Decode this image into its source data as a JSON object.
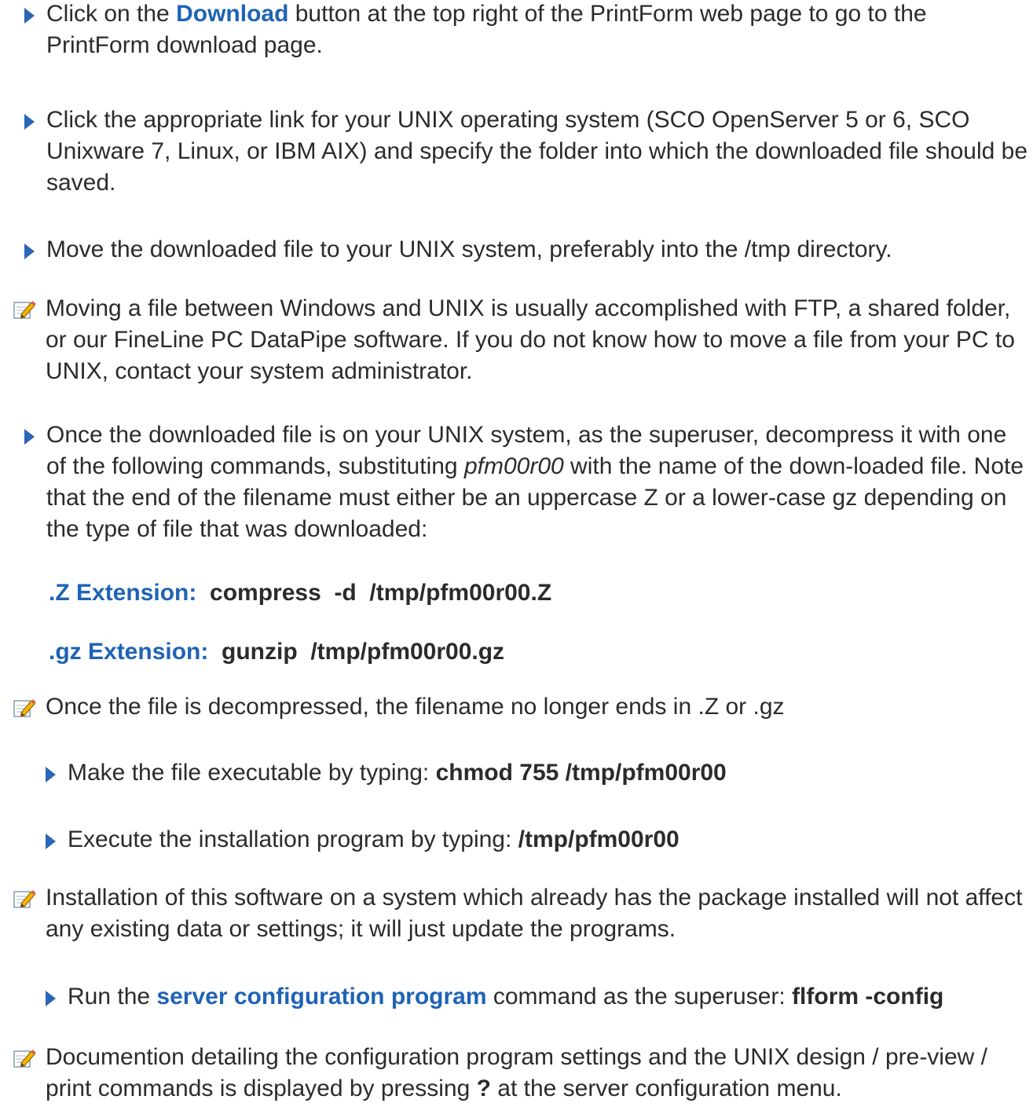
{
  "steps": [
    {
      "pre": "Click on the ",
      "link": "Download",
      "post": " button at the top right of the PrintForm web page to go to the PrintForm download page."
    },
    {
      "text": "Click the appropriate link for your UNIX operating system (SCO OpenServer 5 or 6, SCO Unixware 7, Linux, or IBM AIX) and specify the folder into which the downloaded file should be saved."
    },
    {
      "text": "Move the downloaded file to your UNIX system, preferably into the /tmp directory."
    },
    {
      "note": "Moving a file between Windows and UNIX is usually accomplished with FTP, a shared folder, or our FineLine PC DataPipe software.  If you do not know how to move a file from your PC to UNIX, contact your system administrator."
    },
    {
      "pre": "Once the downloaded file is on your UNIX system, as the superuser, decompress it with one of the following commands, substituting ",
      "italic": "pfm00r00",
      "post": " with the name of the down-loaded file. Note that the end of the filename must either be an uppercase Z or a lower-case gz depending on the type of file that was downloaded:"
    },
    {
      "label": ".Z Extension:",
      "code": "compress  -d  /tmp/pfm00r00.Z"
    },
    {
      "label": ".gz Extension:",
      "code": "gunzip  /tmp/pfm00r00.gz"
    },
    {
      "note": "Once the file is decompressed, the filename no longer ends in .Z or .gz"
    },
    {
      "pre": "Make the file executable by typing:  ",
      "code": "chmod 755  /tmp/pfm00r00"
    },
    {
      "pre": "Execute the installation program by typing:  ",
      "code": "/tmp/pfm00r00"
    },
    {
      "note": "Installation of this software on a system which already has the package installed will not affect any existing data or settings; it will just update the programs."
    },
    {
      "pre": "Run the ",
      "link": "server configuration program",
      "mid": " command as the superuser:  ",
      "code": "flform  -config"
    },
    {
      "pre": "Documention detailing the configuration program settings and the UNIX design / pre-view / print commands is displayed by pressing ",
      "code": "?",
      "post": " at the server configuration menu."
    }
  ]
}
